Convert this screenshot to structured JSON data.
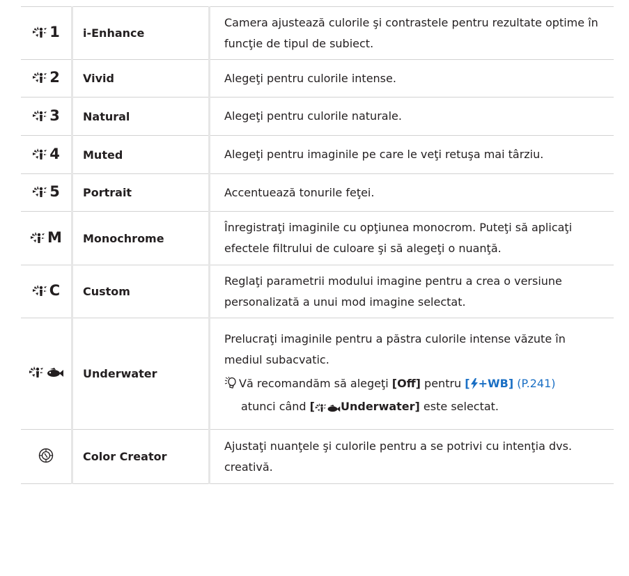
{
  "rows": [
    {
      "suffix": "1",
      "name": "i-Enhance",
      "desc": "Camera ajustează culorile şi contrastele pentru rezultate optime în funcţie de tipul de subiect."
    },
    {
      "suffix": "2",
      "name": "Vivid",
      "desc": "Alegeţi pentru culorile intense."
    },
    {
      "suffix": "3",
      "name": "Natural",
      "desc": "Alegeţi pentru culorile naturale."
    },
    {
      "suffix": "4",
      "name": "Muted",
      "desc": "Alegeţi pentru imaginile pe care le veţi retuşa mai târziu."
    },
    {
      "suffix": "5",
      "name": "Portrait",
      "desc": "Accentuează tonurile feţei."
    },
    {
      "suffix": "M",
      "name": "Monochrome",
      "desc": "Înregistraţi imaginile cu opţiunea monocrom. Puteţi să aplicaţi efectele filtrului de culoare şi să alegeţi o nuanţă."
    },
    {
      "suffix": "C",
      "name": "Custom",
      "desc": "Reglaţi parametrii modului imagine pentru a crea o versiune personalizată a unui mod imagine selectat."
    },
    {
      "name": "Underwater",
      "desc": "Prelucraţi imaginile pentru a păstra culorile intense văzute în mediul subacvatic.",
      "note": {
        "pre": "Vă recomandăm să alegeţi ",
        "off": "[Off]",
        "mid": " pentru ",
        "flash_open": "[",
        "flash_close": "+WB]",
        "ref": "(P.241)",
        "line2_pre": "atunci când ",
        "uw_open": "[",
        "uw_label": "Underwater]",
        "line2_post": " este selectat."
      }
    },
    {
      "name": "Color Creator",
      "desc": "Ajustaţi nuanţele şi culorile pentru a se potrivi cu intenţia dvs. creativă."
    }
  ],
  "icons": {
    "picture_mode": "picture-mode-icon",
    "underwater": "picture-mode-underwater-icon",
    "color_creator": "color-creator-icon",
    "hint": "hint-bulb-icon",
    "flash": "flash-icon"
  },
  "colors": {
    "link": "#1a6fc4",
    "border": "#d2d2d2",
    "divider": "#e6e6e6"
  }
}
